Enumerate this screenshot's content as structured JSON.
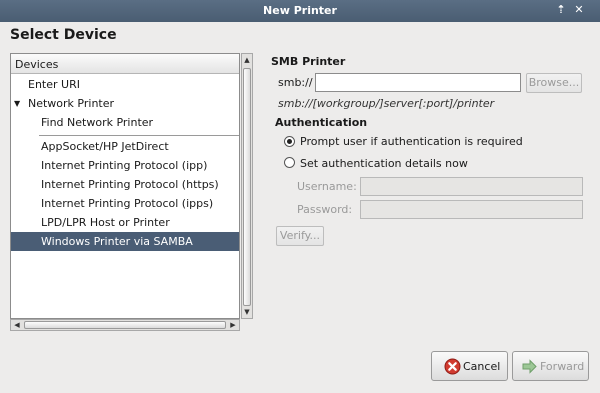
{
  "window": {
    "title": "New Printer",
    "controls": {
      "maximize": "⇡",
      "close": "✕"
    }
  },
  "heading": "Select Device",
  "devices": {
    "header": "Devices",
    "items": [
      {
        "label": "Enter URI"
      },
      {
        "label": "Network Printer",
        "expander": "▼"
      },
      {
        "label": "Find Network Printer"
      },
      {
        "label": "AppSocket/HP JetDirect"
      },
      {
        "label": "Internet Printing Protocol (ipp)"
      },
      {
        "label": "Internet Printing Protocol (https)"
      },
      {
        "label": "Internet Printing Protocol (ipps)"
      },
      {
        "label": "LPD/LPR Host or Printer"
      },
      {
        "label": "Windows Printer via SAMBA",
        "selected": true
      }
    ]
  },
  "smb": {
    "section_title": "SMB Printer",
    "uri_label": "smb://",
    "uri_value": "",
    "browse_button": "Browse...",
    "uri_hint": "smb://[workgroup/]server[:port]/printer"
  },
  "auth": {
    "section_title": "Authentication",
    "prompt_option": "Prompt user if authentication is required",
    "set_option": "Set authentication details now",
    "selected": "prompt",
    "username_label": "Username:",
    "password_label": "Password:",
    "username_value": "",
    "password_value": "",
    "verify_button": "Verify..."
  },
  "footer": {
    "cancel_button": "Cancel",
    "forward_button": "Forward"
  },
  "colors": {
    "titlebar": "#4a5d72",
    "selection": "#4a5d75",
    "cancel_icon": "#d13b30",
    "forward_icon": "#7fb47a"
  }
}
